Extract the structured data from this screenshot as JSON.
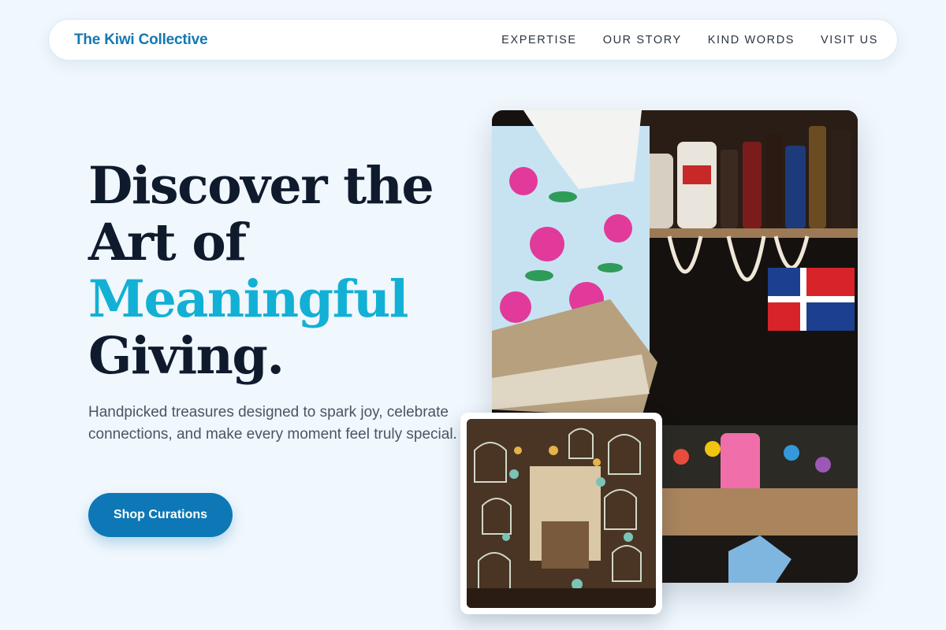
{
  "nav": {
    "brand": "The Kiwi Collective",
    "links": [
      {
        "label": "EXPERTISE"
      },
      {
        "label": "OUR STORY"
      },
      {
        "label": "KIND WORDS"
      },
      {
        "label": "VISIT US"
      }
    ]
  },
  "hero": {
    "headline_line1": "Discover the",
    "headline_line2": "Art of",
    "headline_accent": "Meaningful",
    "headline_line4": "Giving.",
    "subtext": "Handpicked treasures designed to spark joy, celebrate connections, and make every moment feel truly special.",
    "cta_label": "Shop Curations",
    "main_image_icon": "market-stall-photo",
    "thumb_image_icon": "lantern-shop-photo"
  },
  "colors": {
    "brand": "#1279b2",
    "accent": "#12b0d4",
    "cta": "#0d78b5",
    "heading": "#0f1b2d",
    "background": "#f0f7fd"
  }
}
